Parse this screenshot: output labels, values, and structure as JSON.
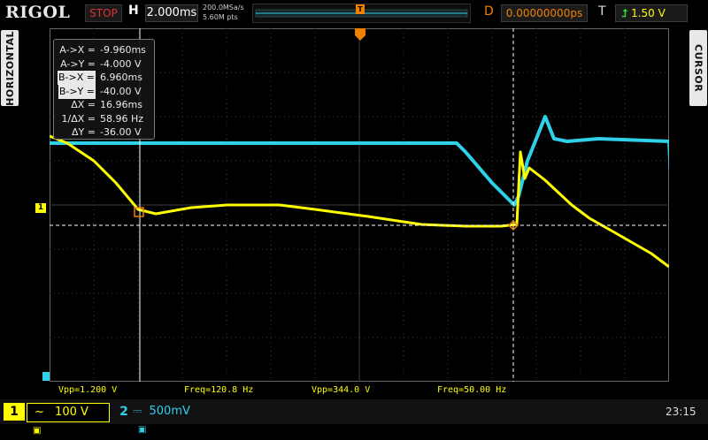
{
  "brand": "RIGOL",
  "run_state": "STOP",
  "horizontal": {
    "label": "H",
    "timebase": "2.000ms",
    "sample_rate": "200.0MSa/s",
    "memory": "5.60M pts"
  },
  "delay": {
    "label": "D",
    "value": "0.00000000ps"
  },
  "trigger": {
    "label": "T",
    "level": "1.50 V",
    "icon": "rising-edge-icon"
  },
  "side_tabs": {
    "left": "HORIZONTAL",
    "right": "CURSOR"
  },
  "cursor_readout": [
    {
      "key": "A->X =",
      "value": "-9.960ms",
      "highlight": false
    },
    {
      "key": "A->Y =",
      "value": "-4.000 V",
      "highlight": false
    },
    {
      "key": "B->X =",
      "value": "6.960ms",
      "highlight": true
    },
    {
      "key": "B->Y =",
      "value": "-40.00 V",
      "highlight": true
    },
    {
      "key": "ΔX =",
      "value": "16.96ms",
      "highlight": false
    },
    {
      "key": "1/ΔX =",
      "value": "58.96 Hz",
      "highlight": false
    },
    {
      "key": "ΔY =",
      "value": "-36.00 V",
      "highlight": false
    }
  ],
  "markers": {
    "ch1": "1",
    "horizontal_pos": "T"
  },
  "measurements": {
    "ch1_vpp": "Vpp=1.200 V",
    "ch1_freq": "Freq=120.8 Hz",
    "ch2_vpp": "Vpp=344.0 V",
    "ch2_freq": "Freq=50.00 Hz"
  },
  "channels": [
    {
      "number": "1",
      "coupling": "~",
      "scale": "100 V",
      "color": "#ffff00"
    },
    {
      "number": "2",
      "coupling": "⎓",
      "scale": "500mV",
      "color": "#30d0e8"
    }
  ],
  "clock": "23:15",
  "colors": {
    "ch1": "#ffff00",
    "ch2": "#30d0e8",
    "accent": "#f08000",
    "grid": "#3c3c3c"
  }
}
